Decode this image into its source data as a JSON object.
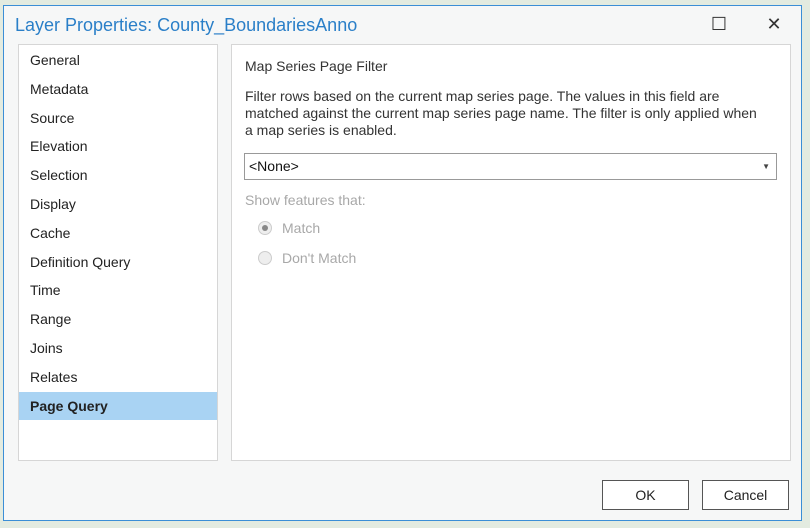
{
  "title": "Layer Properties: County_BoundariesAnno",
  "window": {
    "maximize": "☐",
    "close": "✕"
  },
  "sidebar": {
    "items": [
      {
        "label": "General"
      },
      {
        "label": "Metadata"
      },
      {
        "label": "Source"
      },
      {
        "label": "Elevation"
      },
      {
        "label": "Selection"
      },
      {
        "label": "Display"
      },
      {
        "label": "Cache"
      },
      {
        "label": "Definition Query"
      },
      {
        "label": "Time"
      },
      {
        "label": "Range"
      },
      {
        "label": "Joins"
      },
      {
        "label": "Relates"
      },
      {
        "label": "Page Query"
      }
    ],
    "selected": "Page Query"
  },
  "panel": {
    "heading": "Map Series Page Filter",
    "description": "Filter rows based on the current map series page. The values in this field are matched against the current map series page name. The filter is only applied when a map series is enabled.",
    "field_value": "<None>",
    "show_label": "Show features that:",
    "options": [
      {
        "label": "Match",
        "checked": true
      },
      {
        "label": "Don't Match",
        "checked": false
      }
    ]
  },
  "buttons": {
    "ok": "OK",
    "cancel": "Cancel"
  }
}
